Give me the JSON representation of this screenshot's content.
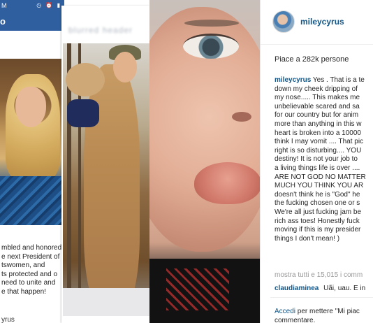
{
  "left_panel": {
    "status_time": "M",
    "status_icons": "◷ ⏰ ▮",
    "nav_label": "o",
    "caption_lines": [
      "mbled and honored",
      "e next President of",
      "tswomen, and",
      "ts protected and o",
      "need to unite and",
      "e that happen!"
    ],
    "footer_name": "yrus"
  },
  "middle_panel": {
    "blurred_title": "blurred header"
  },
  "post": {
    "username": "mileycyrus",
    "likes_text": "Piace a 282k persone",
    "caption_author": "mileycyrus",
    "caption_lines": [
      "Yes . That is a te",
      "down my cheek dripping of",
      "my nose..... This makes me",
      "unbelievable scared and sa",
      "for our country but for anim",
      "more than anything in this w",
      "heart is broken into a 10000",
      "think I may vomit .... That pic",
      "right is so disturbing.... YOU",
      "destiny! It is not your job to",
      "a living things life is over ....",
      "ARE NOT GOD NO MATTER",
      "MUCH YOU THINK YOU AR",
      "doesn't think he is \"God\" he",
      "the fucking chosen one or s",
      "We're all just fucking jam be",
      "rich ass toes! Honestly fuck",
      "moving if this is my presider",
      "things I don't mean! )"
    ],
    "view_all": "mostra tutti e 15,015 i comm",
    "comment": {
      "user": "claudiaminea",
      "text": "Uãi, uau. E in"
    },
    "login_link": "Accedi",
    "login_text_1": "per mettere \"Mi piac",
    "login_text_2": "commentare."
  }
}
